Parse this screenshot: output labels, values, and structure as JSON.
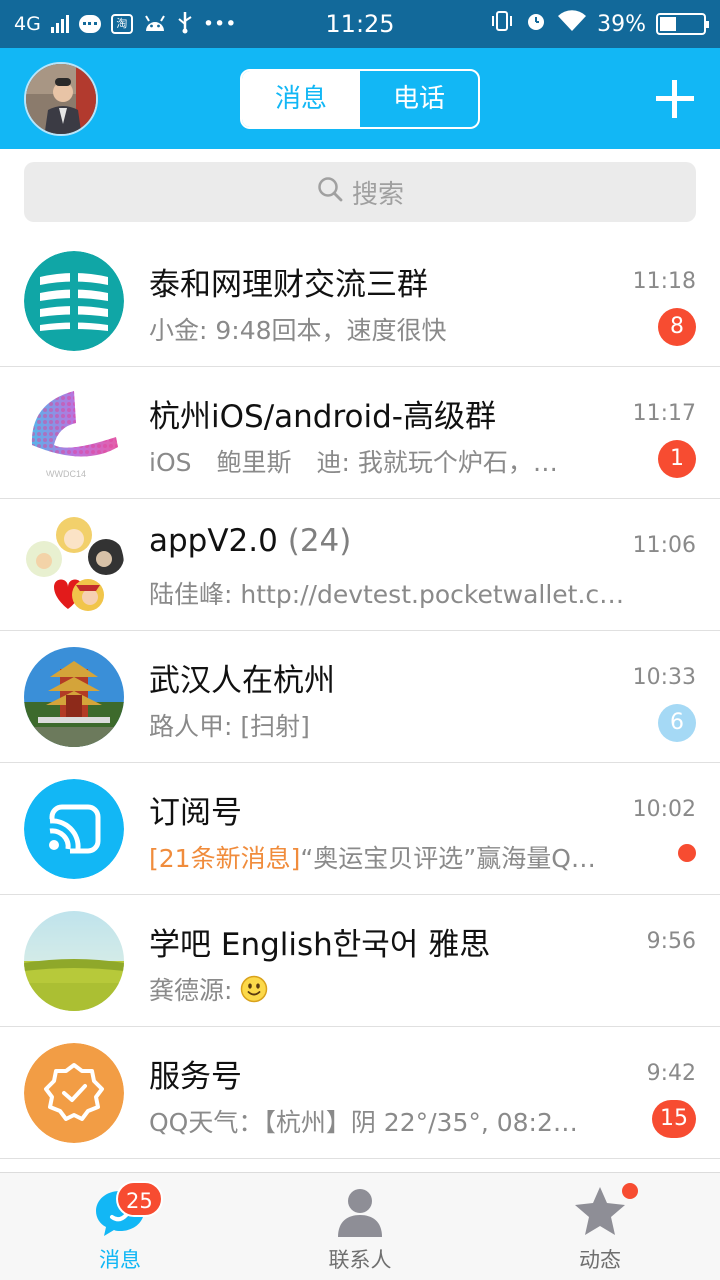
{
  "status_bar": {
    "network": "4G",
    "time": "11:25",
    "battery": "39%",
    "battery_level": 0.39,
    "app_icon_text": "淘",
    "more": "•••"
  },
  "header": {
    "tabs": [
      {
        "label": "消息",
        "active": true
      },
      {
        "label": "电话",
        "active": false
      }
    ],
    "add_icon": "plus-icon"
  },
  "search": {
    "placeholder": "搜索",
    "icon": "search-icon"
  },
  "conversations": [
    {
      "title": "泰和网理财交流三群",
      "count": "",
      "time": "11:18",
      "prefix": "",
      "preview": "小金: 9:48回本，速度很快",
      "badge": "8",
      "badge_style": "red"
    },
    {
      "title": "杭州iOS/android-高级群",
      "count": "",
      "time": "11:17",
      "prefix": "",
      "preview": "iOS　鲍里斯　迪: 我就玩个炉石，…",
      "badge": "1",
      "badge_style": "red"
    },
    {
      "title": "appV2.0",
      "count": "(24)",
      "time": "11:06",
      "prefix": "",
      "preview": "陆佳峰: http://devtest.pocketwallet.cn/do…",
      "badge": "",
      "badge_style": "none"
    },
    {
      "title": "武汉人在杭州",
      "count": "",
      "time": "10:33",
      "prefix": "",
      "preview": "路人甲: [扫射]",
      "badge": "6",
      "badge_style": "muted"
    },
    {
      "title": "订阅号",
      "count": "",
      "time": "10:02",
      "prefix": "[21条新消息]",
      "preview": "“奥运宝贝评选”赢海量Q…",
      "badge": "",
      "badge_style": "dot"
    },
    {
      "title": "学吧 English한국어 雅思",
      "count": "",
      "time": "9:56",
      "prefix": "",
      "preview": "龚德源: ",
      "badge": "",
      "badge_style": "none",
      "emoji": "smile-emoji"
    },
    {
      "title": "服务号",
      "count": "",
      "time": "9:42",
      "prefix": "",
      "preview": "QQ天气：【杭州】阴 22°/35°, 08:2…",
      "badge": "15",
      "badge_style": "red"
    }
  ],
  "tabbar": {
    "messages": {
      "label": "消息",
      "badge": "25"
    },
    "contacts": {
      "label": "联系人"
    },
    "moments": {
      "label": "动态",
      "has_dot": true
    }
  },
  "colors": {
    "header": "#12b7f5",
    "status_bar": "#12699a",
    "badge": "#f74c31",
    "highlight": "#f08c3c"
  }
}
